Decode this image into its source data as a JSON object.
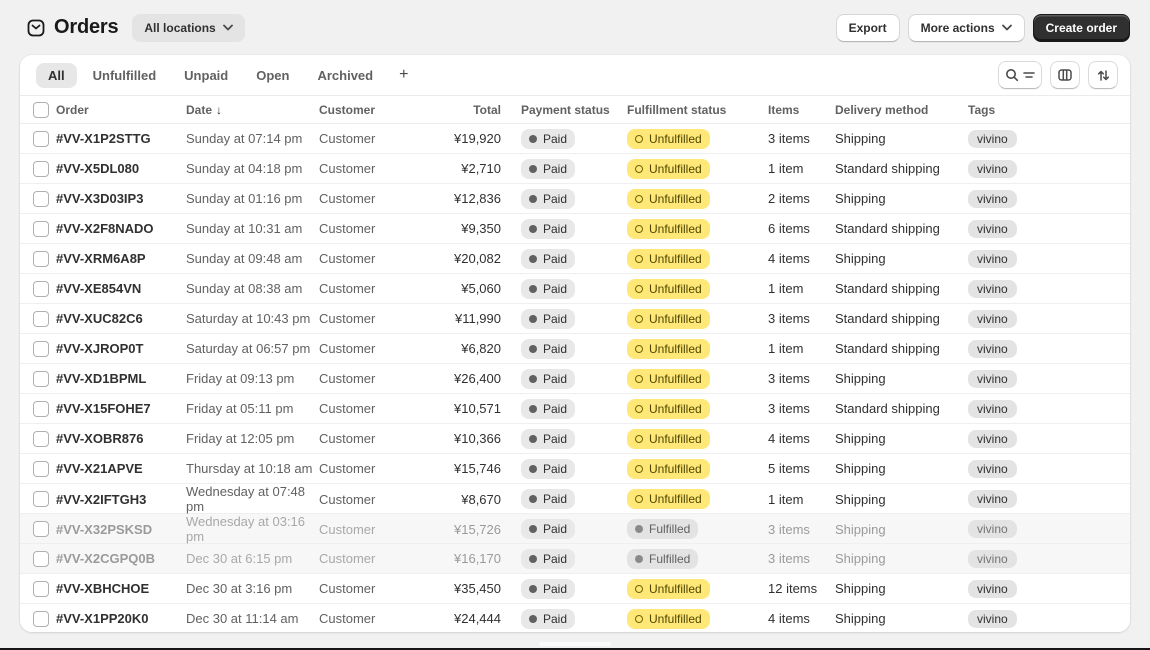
{
  "header": {
    "title": "Orders",
    "location_button": "All locations",
    "export_button": "Export",
    "more_actions_button": "More actions",
    "create_order_button": "Create order"
  },
  "tabs": {
    "items": [
      "All",
      "Unfulfilled",
      "Unpaid",
      "Open",
      "Archived"
    ],
    "active_tab": "All",
    "add_view_button": "+"
  },
  "table": {
    "columns": [
      "Order",
      "Date",
      "Customer",
      "Total",
      "Payment status",
      "Fulfillment status",
      "Items",
      "Delivery method",
      "Tags"
    ],
    "sorted_by": "Date",
    "sort_direction": "descending",
    "sort_arrow": "↓",
    "rows": [
      {
        "order": "#VV-X1P2STTG",
        "date": "Sunday at 07:14 pm",
        "customer": "Customer",
        "total": "¥19,920",
        "payment_status": "Paid",
        "fulfillment_status": "Unfulfilled",
        "items": "3 items",
        "delivery_method": "Shipping",
        "tags": "vivino",
        "muted": false
      },
      {
        "order": "#VV-X5DL080",
        "date": "Sunday at 04:18 pm",
        "customer": "Customer",
        "total": "¥2,710",
        "payment_status": "Paid",
        "fulfillment_status": "Unfulfilled",
        "items": "1 item",
        "delivery_method": "Standard shipping",
        "tags": "vivino",
        "muted": false
      },
      {
        "order": "#VV-X3D03IP3",
        "date": "Sunday at 01:16 pm",
        "customer": "Customer",
        "total": "¥12,836",
        "payment_status": "Paid",
        "fulfillment_status": "Unfulfilled",
        "items": "2 items",
        "delivery_method": "Shipping",
        "tags": "vivino",
        "muted": false
      },
      {
        "order": "#VV-X2F8NADO",
        "date": "Sunday at 10:31 am",
        "customer": "Customer",
        "total": "¥9,350",
        "payment_status": "Paid",
        "fulfillment_status": "Unfulfilled",
        "items": "6 items",
        "delivery_method": "Standard shipping",
        "tags": "vivino",
        "muted": false
      },
      {
        "order": "#VV-XRM6A8P",
        "date": "Sunday at 09:48 am",
        "customer": "Customer",
        "total": "¥20,082",
        "payment_status": "Paid",
        "fulfillment_status": "Unfulfilled",
        "items": "4 items",
        "delivery_method": "Shipping",
        "tags": "vivino",
        "muted": false
      },
      {
        "order": "#VV-XE854VN",
        "date": "Sunday at 08:38 am",
        "customer": "Customer",
        "total": "¥5,060",
        "payment_status": "Paid",
        "fulfillment_status": "Unfulfilled",
        "items": "1 item",
        "delivery_method": "Standard shipping",
        "tags": "vivino",
        "muted": false
      },
      {
        "order": "#VV-XUC82C6",
        "date": "Saturday at 10:43 pm",
        "customer": "Customer",
        "total": "¥11,990",
        "payment_status": "Paid",
        "fulfillment_status": "Unfulfilled",
        "items": "3 items",
        "delivery_method": "Standard shipping",
        "tags": "vivino",
        "muted": false
      },
      {
        "order": "#VV-XJROP0T",
        "date": "Saturday at 06:57 pm",
        "customer": "Customer",
        "total": "¥6,820",
        "payment_status": "Paid",
        "fulfillment_status": "Unfulfilled",
        "items": "1 item",
        "delivery_method": "Standard shipping",
        "tags": "vivino",
        "muted": false
      },
      {
        "order": "#VV-XD1BPML",
        "date": "Friday at 09:13 pm",
        "customer": "Customer",
        "total": "¥26,400",
        "payment_status": "Paid",
        "fulfillment_status": "Unfulfilled",
        "items": "3 items",
        "delivery_method": "Shipping",
        "tags": "vivino",
        "muted": false
      },
      {
        "order": "#VV-X15FOHE7",
        "date": "Friday at 05:11 pm",
        "customer": "Customer",
        "total": "¥10,571",
        "payment_status": "Paid",
        "fulfillment_status": "Unfulfilled",
        "items": "3 items",
        "delivery_method": "Standard shipping",
        "tags": "vivino",
        "muted": false
      },
      {
        "order": "#VV-XOBR876",
        "date": "Friday at 12:05 pm",
        "customer": "Customer",
        "total": "¥10,366",
        "payment_status": "Paid",
        "fulfillment_status": "Unfulfilled",
        "items": "4 items",
        "delivery_method": "Shipping",
        "tags": "vivino",
        "muted": false
      },
      {
        "order": "#VV-X21APVE",
        "date": "Thursday at 10:18 am",
        "customer": "Customer",
        "total": "¥15,746",
        "payment_status": "Paid",
        "fulfillment_status": "Unfulfilled",
        "items": "5 items",
        "delivery_method": "Shipping",
        "tags": "vivino",
        "muted": false
      },
      {
        "order": "#VV-X2IFTGH3",
        "date": "Wednesday at 07:48 pm",
        "customer": "Customer",
        "total": "¥8,670",
        "payment_status": "Paid",
        "fulfillment_status": "Unfulfilled",
        "items": "1 item",
        "delivery_method": "Shipping",
        "tags": "vivino",
        "muted": false
      },
      {
        "order": "#VV-X32PSKSD",
        "date": "Wednesday at 03:16 pm",
        "customer": "Customer",
        "total": "¥15,726",
        "payment_status": "Paid",
        "fulfillment_status": "Fulfilled",
        "items": "3 items",
        "delivery_method": "Shipping",
        "tags": "vivino",
        "muted": true
      },
      {
        "order": "#VV-X2CGPQ0B",
        "date": "Dec 30 at 6:15 pm",
        "customer": "Customer",
        "total": "¥16,170",
        "payment_status": "Paid",
        "fulfillment_status": "Fulfilled",
        "items": "3 items",
        "delivery_method": "Shipping",
        "tags": "vivino",
        "muted": true
      },
      {
        "order": "#VV-XBHCHOE",
        "date": "Dec 30 at 3:16 pm",
        "customer": "Customer",
        "total": "¥35,450",
        "payment_status": "Paid",
        "fulfillment_status": "Unfulfilled",
        "items": "12 items",
        "delivery_method": "Shipping",
        "tags": "vivino",
        "muted": false
      },
      {
        "order": "#VV-X1PP20K0",
        "date": "Dec 30 at 11:14 am",
        "customer": "Customer",
        "total": "¥24,444",
        "payment_status": "Paid",
        "fulfillment_status": "Unfulfilled",
        "items": "4 items",
        "delivery_method": "Shipping",
        "tags": "vivino",
        "muted": false
      }
    ]
  },
  "colors": {
    "page_bg": "#f1f1f1",
    "primary_button_bg": "#303030",
    "badge_paid_bg": "#e8e8e8",
    "badge_unfulfilled_bg": "#ffe878",
    "badge_fulfilled_bg": "#e3e3e3",
    "tag_bg": "#e3e3e3"
  }
}
